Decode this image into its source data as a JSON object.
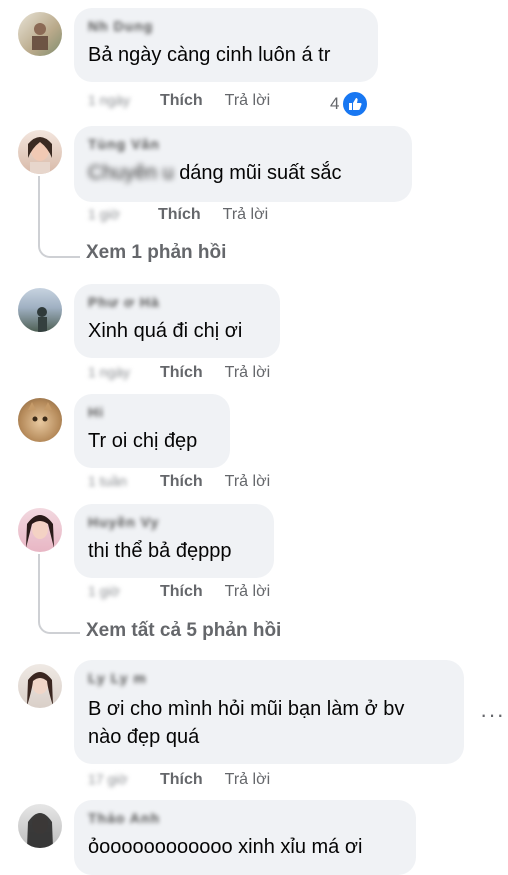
{
  "actions": {
    "like_label": "Thích",
    "reply_label": "Trả lời"
  },
  "comments": [
    {
      "name": "Nh  Dung",
      "text": "Bả ngày càng cinh luôn á tr",
      "time": "1 ngày",
      "reaction_count": "4"
    },
    {
      "name": "Tùng Vân",
      "text_prefix": "Chuyên   u",
      "text": "dáng mũi suất sắc",
      "time": "1 giờ"
    },
    {
      "name": "Phư ơ Hà",
      "text": "Xinh quá đi chị ơi",
      "time": "1 ngày"
    },
    {
      "name": "Hi",
      "text": "Tr oi chị đẹp",
      "time": "1 tuần"
    },
    {
      "name": "Huyền Vy",
      "text": "thi thể bả đẹppp",
      "time": "1 giờ"
    },
    {
      "name": "Ly Ly  m",
      "text_line1": "B ơi cho mình hỏi mũi bạn làm ở bv",
      "text_line2": "nào đẹp quá",
      "time": "17 giờ"
    },
    {
      "name": "  Thảo Anh",
      "text": "ỏoooooooooooo xinh xỉu má ơi"
    }
  ],
  "replies": {
    "first": "Xem 1 phản hồi",
    "second": "Xem tất cả 5 phản hồi"
  },
  "more_options": "···",
  "colors": {
    "like_blue": "#1877f2",
    "bubble_bg": "#f0f2f5",
    "muted": "#65676b"
  }
}
